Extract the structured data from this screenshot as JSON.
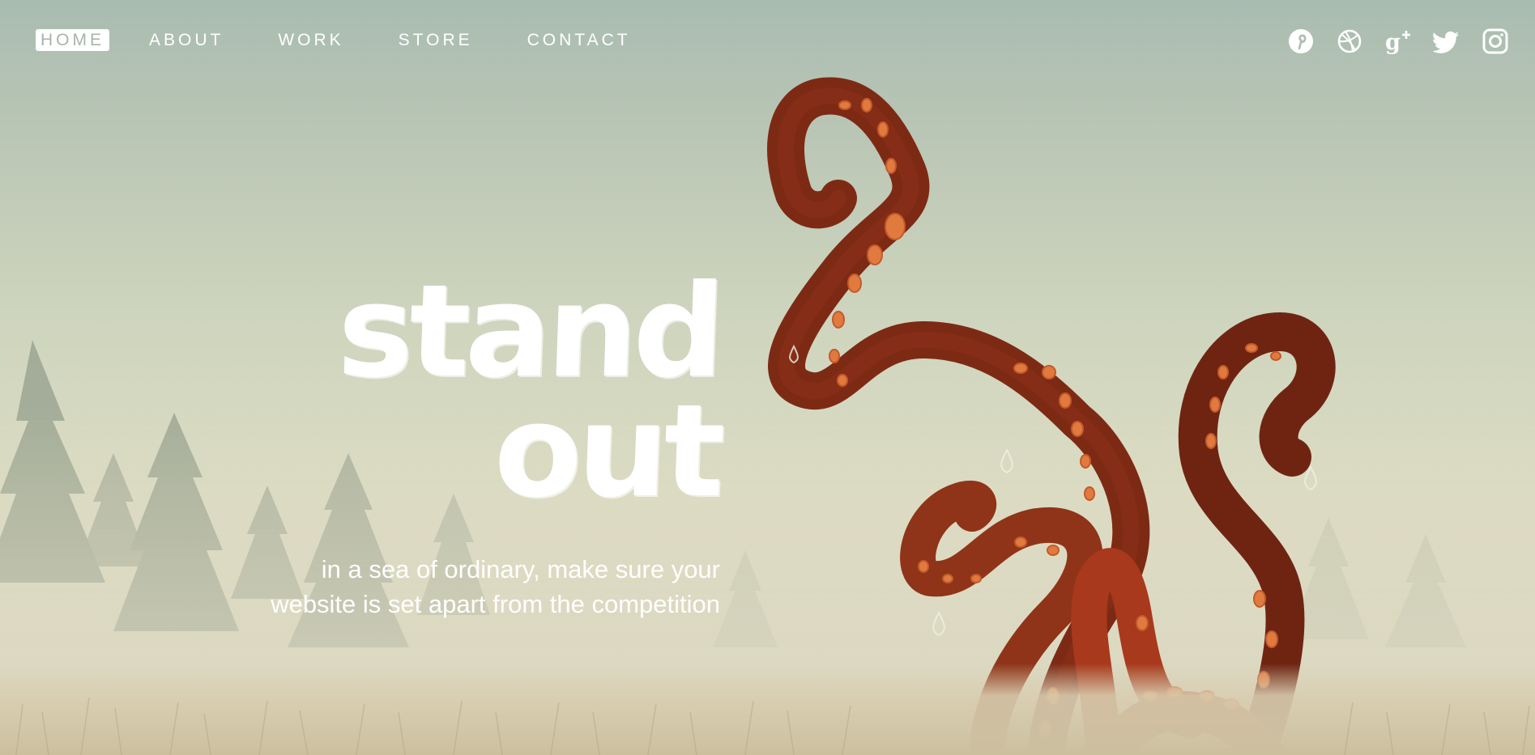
{
  "nav": {
    "items": [
      {
        "label": "HOME",
        "active": true
      },
      {
        "label": "ABOUT",
        "active": false
      },
      {
        "label": "WORK",
        "active": false
      },
      {
        "label": "STORE",
        "active": false
      },
      {
        "label": "CONTACT",
        "active": false
      }
    ]
  },
  "social": [
    "pinterest-icon",
    "dribbble-icon",
    "google-plus-icon",
    "twitter-icon",
    "instagram-icon"
  ],
  "hero": {
    "title_line1": "stand",
    "title_line2": "out",
    "subtitle_line1": "in a sea of ordinary, make sure your",
    "subtitle_line2": "website is set apart from the competition"
  },
  "colors": {
    "sky_top": "#a9bcb1",
    "fog": "#dcdcc3",
    "tentacle": "#8a2f18",
    "tentacle_dark": "#6f2412",
    "sucker": "#e07a3e",
    "text": "#ffffff"
  }
}
